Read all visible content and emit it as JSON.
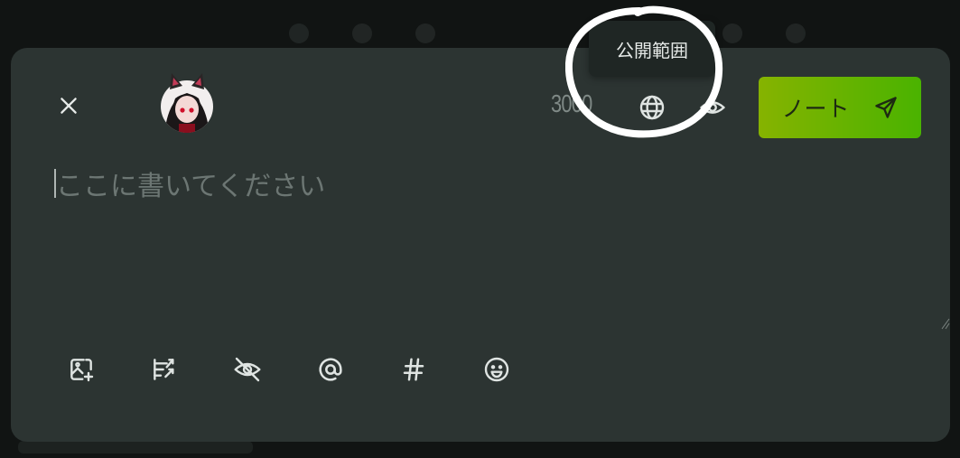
{
  "composer": {
    "char_count": "3000",
    "placeholder": "ここに書いてください",
    "submit_label": "ノート"
  },
  "tooltip": {
    "text": "公開範囲"
  },
  "icons": {
    "close": "close-icon",
    "visibility": "globe-icon",
    "local_only": "eye-icon",
    "submit": "send-icon",
    "footer": [
      "image-plus-icon",
      "poll-icon",
      "eye-off-icon",
      "at-sign-icon",
      "hashtag-icon",
      "emoji-icon"
    ]
  },
  "colors": {
    "dialog_bg": "#2c3432",
    "accent_start": "#86b300",
    "accent_end": "#4ab300",
    "icon": "#cfd6d4",
    "tooltip_bg": "#1f2624",
    "annotation": "#ffffff"
  }
}
